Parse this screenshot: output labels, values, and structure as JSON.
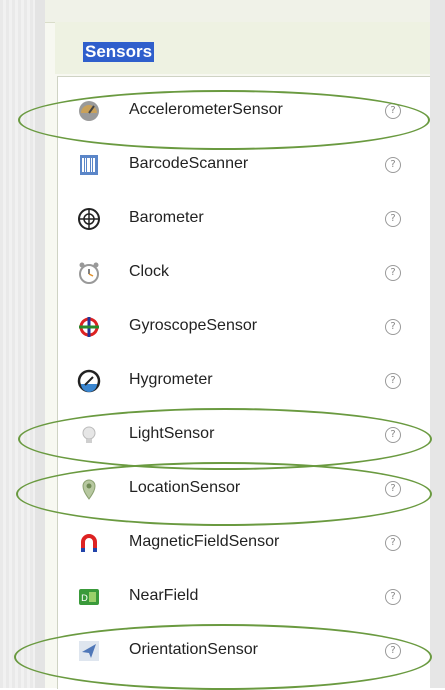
{
  "category": {
    "title": "Sensors"
  },
  "items": [
    {
      "label": "AccelerometerSensor",
      "icon": "accelerometer-icon",
      "help": "?",
      "highlighted": true
    },
    {
      "label": "BarcodeScanner",
      "icon": "barcode-scanner-icon",
      "help": "?",
      "highlighted": false
    },
    {
      "label": "Barometer",
      "icon": "barometer-icon",
      "help": "?",
      "highlighted": false
    },
    {
      "label": "Clock",
      "icon": "clock-icon",
      "help": "?",
      "highlighted": false
    },
    {
      "label": "GyroscopeSensor",
      "icon": "gyroscope-icon",
      "help": "?",
      "highlighted": false
    },
    {
      "label": "Hygrometer",
      "icon": "hygrometer-icon",
      "help": "?",
      "highlighted": false
    },
    {
      "label": "LightSensor",
      "icon": "light-sensor-icon",
      "help": "?",
      "highlighted": true
    },
    {
      "label": "LocationSensor",
      "icon": "location-sensor-icon",
      "help": "?",
      "highlighted": true
    },
    {
      "label": "MagneticFieldSensor",
      "icon": "magnetic-field-icon",
      "help": "?",
      "highlighted": false
    },
    {
      "label": "NearField",
      "icon": "near-field-icon",
      "help": "?",
      "highlighted": false
    },
    {
      "label": "OrientationSensor",
      "icon": "orientation-sensor-icon",
      "help": "?",
      "highlighted": true
    }
  ],
  "colors": {
    "highlight_oval": "#6a9a40",
    "category_title_bg": "#2f5fcc"
  }
}
